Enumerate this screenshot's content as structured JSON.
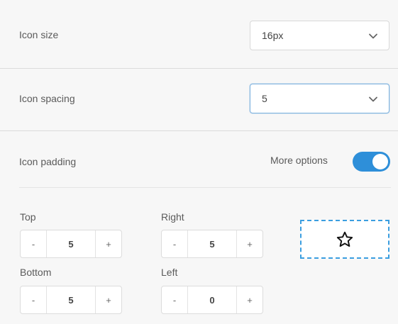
{
  "icon_size": {
    "label": "Icon size",
    "value": "16px"
  },
  "icon_spacing": {
    "label": "Icon spacing",
    "value": "5"
  },
  "icon_padding": {
    "label": "Icon padding",
    "more_options_label": "More options",
    "more_options_enabled": true
  },
  "padding": {
    "top": {
      "label": "Top",
      "value": "5"
    },
    "right": {
      "label": "Right",
      "value": "5"
    },
    "bottom": {
      "label": "Bottom",
      "value": "5"
    },
    "left": {
      "label": "Left",
      "value": "0"
    },
    "minus_label": "-",
    "plus_label": "+"
  },
  "preview": {
    "icon": "star-outline-icon"
  },
  "colors": {
    "accent": "#2e8fd9",
    "focus_border": "#7eb2de",
    "preview_border": "#3b9ee0"
  }
}
